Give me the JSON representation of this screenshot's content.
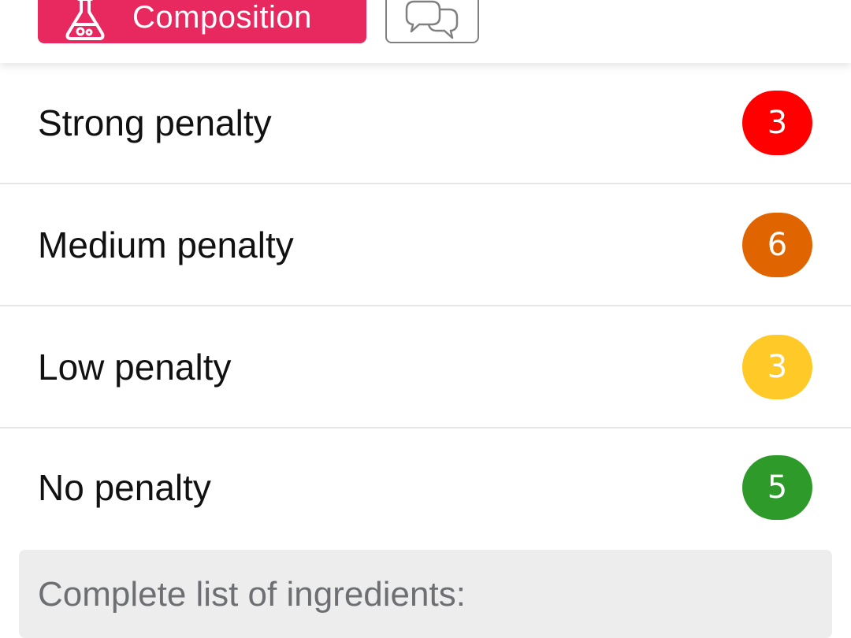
{
  "tabs": {
    "composition": {
      "label": "Composition",
      "icon": "flask-icon",
      "color": "#e72960"
    },
    "reviews": {
      "icon": "chat-bubbles-icon"
    }
  },
  "penalties": [
    {
      "label": "Strong penalty",
      "count": "3",
      "color": "#ff0000"
    },
    {
      "label": "Medium penalty",
      "count": "6",
      "color": "#e06400"
    },
    {
      "label": "Low penalty",
      "count": "3",
      "color": "#ffc928"
    },
    {
      "label": "No penalty",
      "count": "5",
      "color": "#2e9a2a"
    }
  ],
  "ingredients": {
    "title": "Complete list of ingredients:"
  }
}
